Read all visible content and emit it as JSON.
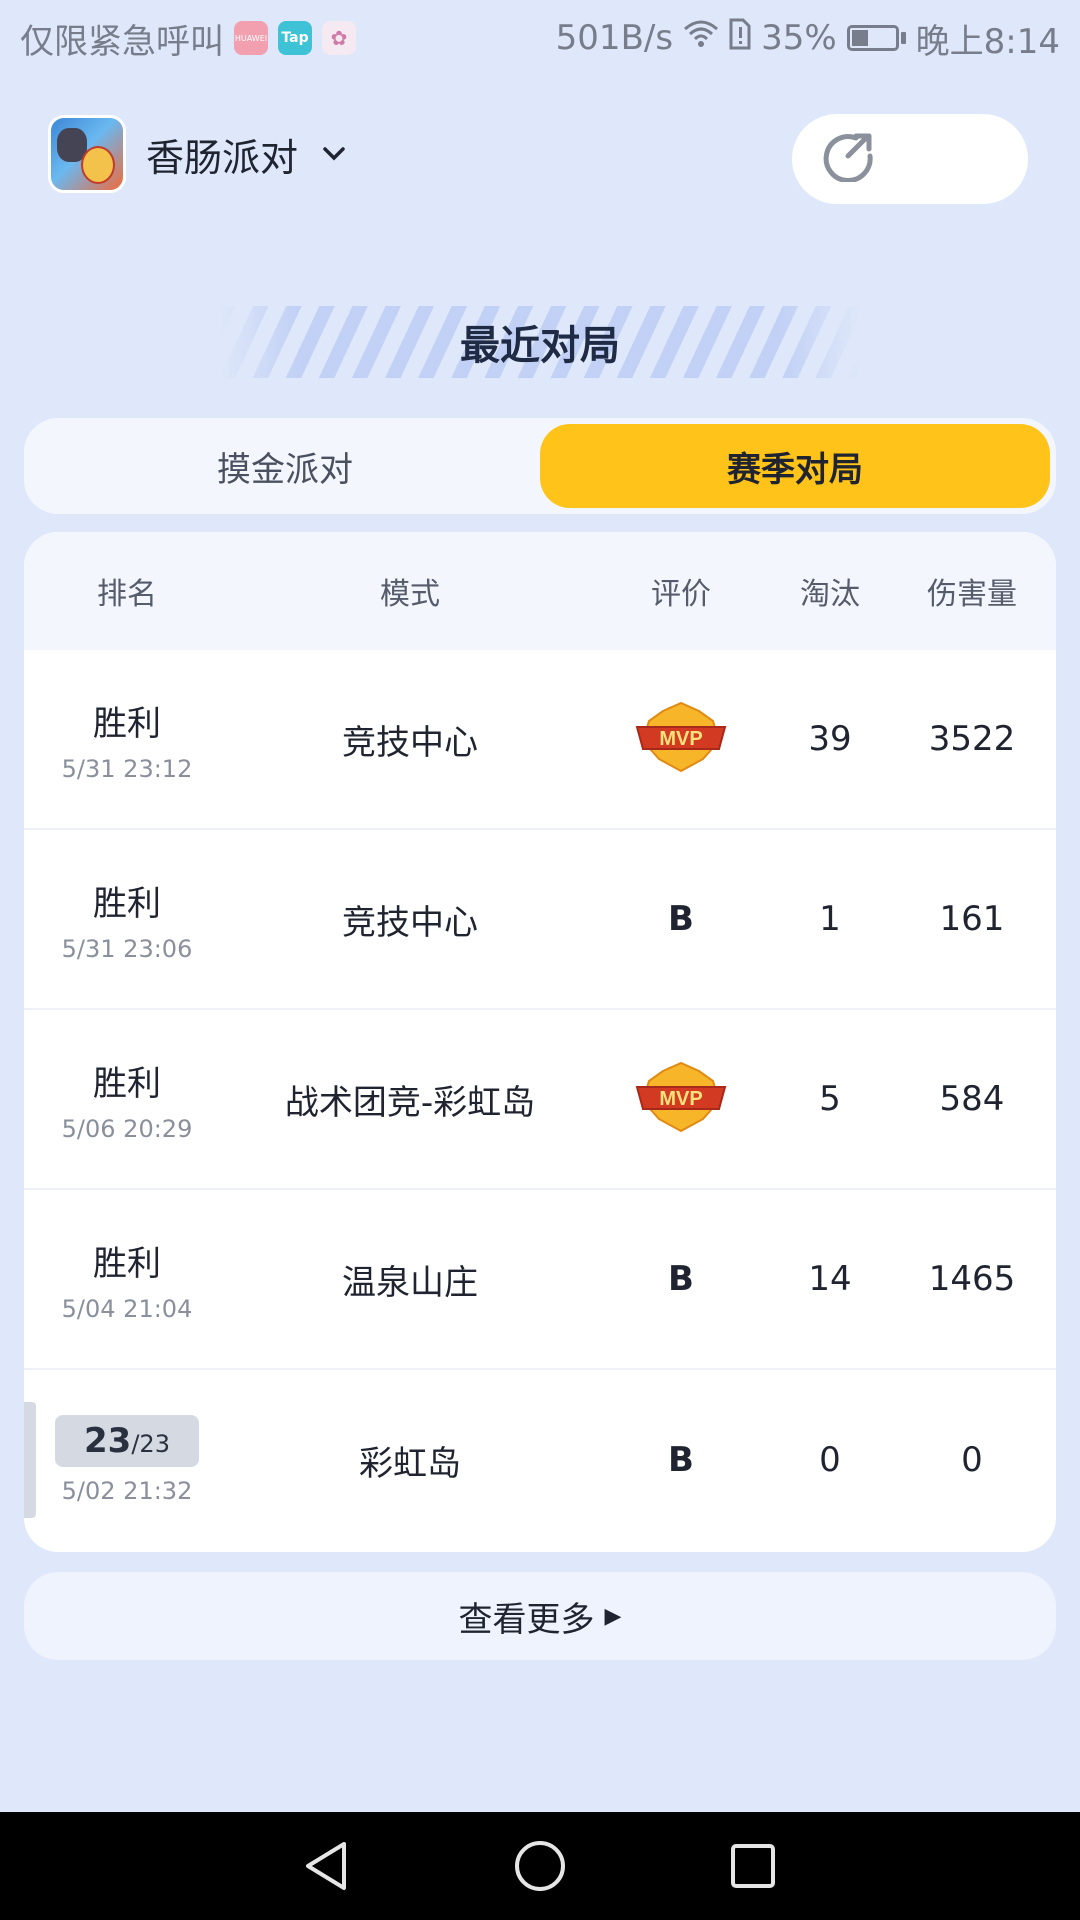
{
  "status_bar": {
    "carrier_text": "仅限紧急呼叫",
    "app_icons": [
      "HUAWEI",
      "Tap",
      "✿"
    ],
    "speed": "501B/s",
    "battery": "35%",
    "time": "晚上8:14"
  },
  "header": {
    "game_name": "香肠派对",
    "chevron": "⌄"
  },
  "section": {
    "title": "最近对局"
  },
  "tabs": [
    {
      "label": "摸金派对",
      "active": false
    },
    {
      "label": "赛季对局",
      "active": true
    }
  ],
  "table": {
    "headers": {
      "rank": "排名",
      "mode": "模式",
      "rating": "评价",
      "elim": "淘汰",
      "damage": "伤害量"
    },
    "rows": [
      {
        "result": "胜利",
        "time": "5/31 23:12",
        "mode": "竞技中心",
        "rating": "MVP",
        "elim": "39",
        "damage": "3522"
      },
      {
        "result": "胜利",
        "time": "5/31 23:06",
        "mode": "竞技中心",
        "rating": "B",
        "elim": "1",
        "damage": "161"
      },
      {
        "result": "胜利",
        "time": "5/06 20:29",
        "mode": "战术团竞-彩虹岛",
        "rating": "MVP",
        "elim": "5",
        "damage": "584"
      },
      {
        "result": "胜利",
        "time": "5/04 21:04",
        "mode": "温泉山庄",
        "rating": "B",
        "elim": "14",
        "damage": "1465"
      },
      {
        "rank": "23",
        "rank_total": "/23",
        "time": "5/02 21:32",
        "mode": "彩虹岛",
        "rating": "B",
        "elim": "0",
        "damage": "0"
      }
    ]
  },
  "more": {
    "label": "查看更多",
    "arrow": "▶"
  },
  "colors": {
    "accent": "#ffc31a",
    "background": "#dfe8fa",
    "mvp_red": "#d23a22",
    "mvp_gold": "#f7b62a"
  }
}
